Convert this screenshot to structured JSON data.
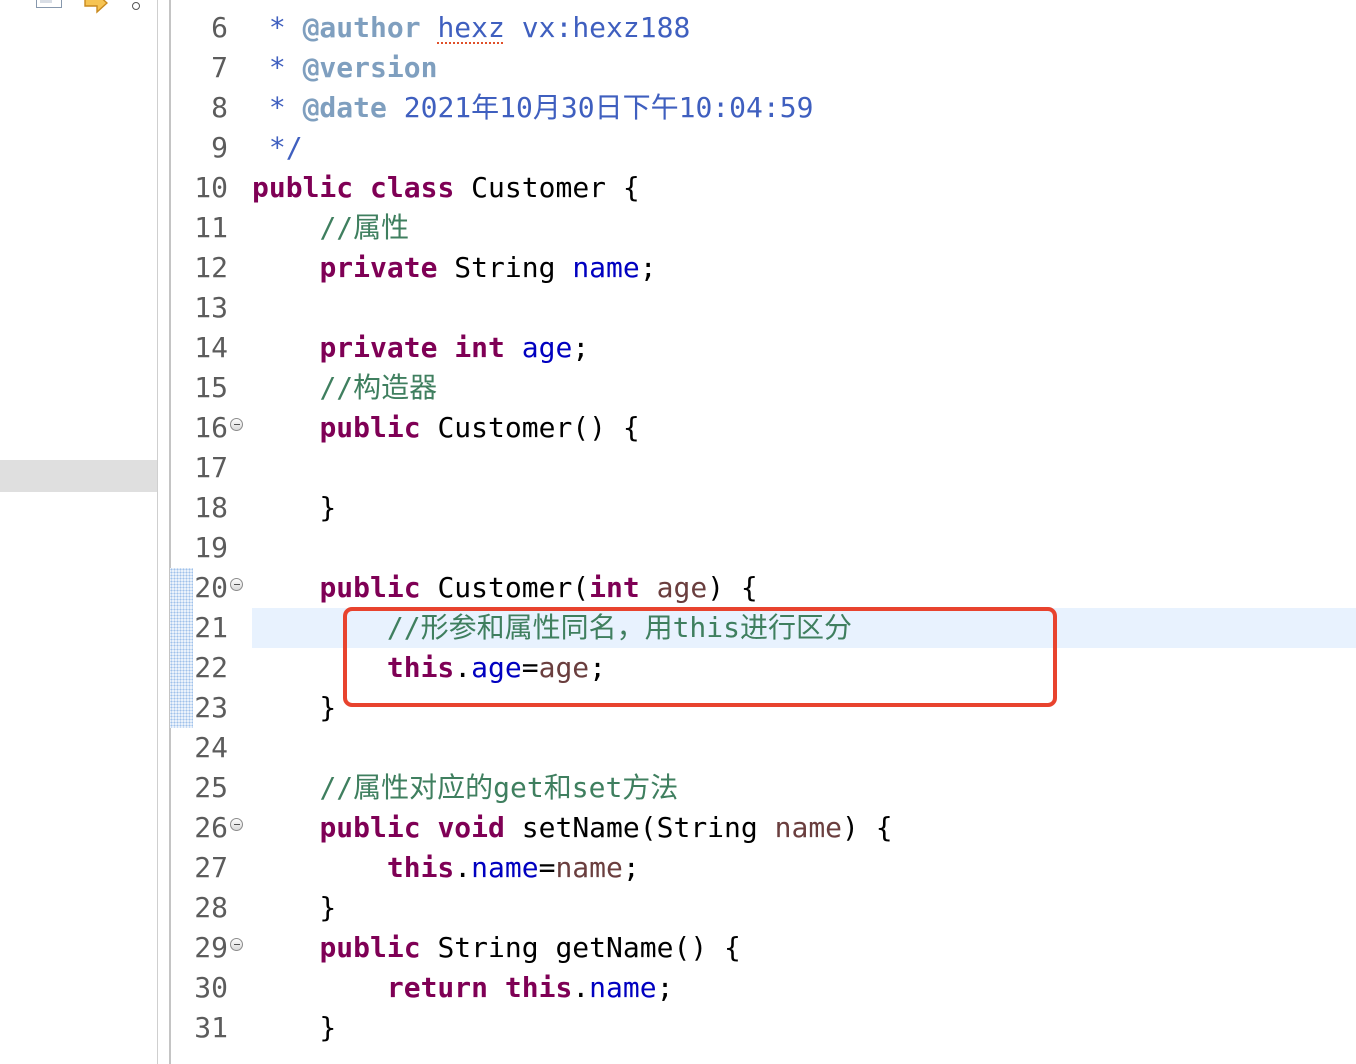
{
  "package_explorer": {
    "toolbar_icons": {
      "collapse_all": "collapse-all-icon",
      "link_with_editor": "link-with-editor-icon",
      "view_menu": "view-menu-icon"
    },
    "selected_row_color": "#dfdfdf"
  },
  "editor": {
    "current_line_color": "#e8f2fe",
    "annotation_color": "#e8432e",
    "fold_icon": "fold-collapse-icon",
    "syntax_colors": {
      "plain": "#000000",
      "keyword": "#7f0055",
      "comment": "#3f7f5f",
      "field": "#0000c0",
      "param": "#6a3e3e",
      "javadoc": "#3f5fbf",
      "javadoc_tag": "#7f9fbf",
      "spell_error": "#e0502a"
    },
    "lines": [
      {
        "number": "6",
        "tokens": [
          {
            "text": " * ",
            "kind": "javadoc"
          },
          {
            "text": "@author",
            "kind": "javadoc_tag"
          },
          {
            "text": " ",
            "kind": "javadoc"
          },
          {
            "text": "hexz",
            "kind": "javadoc",
            "misspelled": true
          },
          {
            "text": " vx:hexz188",
            "kind": "javadoc"
          }
        ]
      },
      {
        "number": "7",
        "tokens": [
          {
            "text": " * ",
            "kind": "javadoc"
          },
          {
            "text": "@version",
            "kind": "javadoc_tag"
          }
        ]
      },
      {
        "number": "8",
        "tokens": [
          {
            "text": " * ",
            "kind": "javadoc"
          },
          {
            "text": "@date",
            "kind": "javadoc_tag"
          },
          {
            "text": " 2021年10月30日下午10:04:59",
            "kind": "javadoc"
          }
        ]
      },
      {
        "number": "9",
        "tokens": [
          {
            "text": " */",
            "kind": "javadoc"
          }
        ]
      },
      {
        "number": "10",
        "tokens": [
          {
            "text": "public",
            "kind": "keyword"
          },
          {
            "text": " ",
            "kind": "plain"
          },
          {
            "text": "class",
            "kind": "keyword"
          },
          {
            "text": " Customer {",
            "kind": "plain"
          }
        ]
      },
      {
        "number": "11",
        "tokens": [
          {
            "text": "    ",
            "kind": "plain"
          },
          {
            "text": "//属性",
            "kind": "comment"
          }
        ]
      },
      {
        "number": "12",
        "tokens": [
          {
            "text": "    ",
            "kind": "plain"
          },
          {
            "text": "private",
            "kind": "keyword"
          },
          {
            "text": " String ",
            "kind": "plain"
          },
          {
            "text": "name",
            "kind": "field"
          },
          {
            "text": ";",
            "kind": "plain"
          }
        ]
      },
      {
        "number": "13",
        "tokens": []
      },
      {
        "number": "14",
        "tokens": [
          {
            "text": "    ",
            "kind": "plain"
          },
          {
            "text": "private",
            "kind": "keyword"
          },
          {
            "text": " ",
            "kind": "plain"
          },
          {
            "text": "int",
            "kind": "keyword"
          },
          {
            "text": " ",
            "kind": "plain"
          },
          {
            "text": "age",
            "kind": "field"
          },
          {
            "text": ";",
            "kind": "plain"
          }
        ]
      },
      {
        "number": "15",
        "tokens": [
          {
            "text": "    ",
            "kind": "plain"
          },
          {
            "text": "//构造器",
            "kind": "comment"
          }
        ]
      },
      {
        "number": "16",
        "fold": true,
        "tokens": [
          {
            "text": "    ",
            "kind": "plain"
          },
          {
            "text": "public",
            "kind": "keyword"
          },
          {
            "text": " Customer() {",
            "kind": "plain"
          }
        ]
      },
      {
        "number": "17",
        "tokens": []
      },
      {
        "number": "18",
        "tokens": [
          {
            "text": "    }",
            "kind": "plain"
          }
        ]
      },
      {
        "number": "19",
        "tokens": []
      },
      {
        "number": "20",
        "fold": true,
        "changed": true,
        "tokens": [
          {
            "text": "    ",
            "kind": "plain"
          },
          {
            "text": "public",
            "kind": "keyword"
          },
          {
            "text": " Customer(",
            "kind": "plain"
          },
          {
            "text": "int",
            "kind": "keyword"
          },
          {
            "text": " ",
            "kind": "plain"
          },
          {
            "text": "age",
            "kind": "param"
          },
          {
            "text": ") {",
            "kind": "plain"
          }
        ]
      },
      {
        "number": "21",
        "current": true,
        "changed": true,
        "tokens": [
          {
            "text": "        ",
            "kind": "plain"
          },
          {
            "text": "//形参和属性同名，用this进行区分",
            "kind": "comment"
          }
        ]
      },
      {
        "number": "22",
        "changed": true,
        "tokens": [
          {
            "text": "        ",
            "kind": "plain"
          },
          {
            "text": "this",
            "kind": "keyword"
          },
          {
            "text": ".",
            "kind": "plain"
          },
          {
            "text": "age",
            "kind": "field"
          },
          {
            "text": "=",
            "kind": "plain"
          },
          {
            "text": "age",
            "kind": "param"
          },
          {
            "text": ";",
            "kind": "plain"
          }
        ]
      },
      {
        "number": "23",
        "changed": true,
        "tokens": [
          {
            "text": "    }",
            "kind": "plain"
          }
        ]
      },
      {
        "number": "24",
        "tokens": []
      },
      {
        "number": "25",
        "tokens": [
          {
            "text": "    ",
            "kind": "plain"
          },
          {
            "text": "//属性对应的get和set方法",
            "kind": "comment"
          }
        ]
      },
      {
        "number": "26",
        "fold": true,
        "tokens": [
          {
            "text": "    ",
            "kind": "plain"
          },
          {
            "text": "public",
            "kind": "keyword"
          },
          {
            "text": " ",
            "kind": "plain"
          },
          {
            "text": "void",
            "kind": "keyword"
          },
          {
            "text": " setName(String ",
            "kind": "plain"
          },
          {
            "text": "name",
            "kind": "param"
          },
          {
            "text": ") {",
            "kind": "plain"
          }
        ]
      },
      {
        "number": "27",
        "tokens": [
          {
            "text": "        ",
            "kind": "plain"
          },
          {
            "text": "this",
            "kind": "keyword"
          },
          {
            "text": ".",
            "kind": "plain"
          },
          {
            "text": "name",
            "kind": "field"
          },
          {
            "text": "=",
            "kind": "plain"
          },
          {
            "text": "name",
            "kind": "param"
          },
          {
            "text": ";",
            "kind": "plain"
          }
        ]
      },
      {
        "number": "28",
        "tokens": [
          {
            "text": "    }",
            "kind": "plain"
          }
        ]
      },
      {
        "number": "29",
        "fold": true,
        "tokens": [
          {
            "text": "    ",
            "kind": "plain"
          },
          {
            "text": "public",
            "kind": "keyword"
          },
          {
            "text": " String getName() {",
            "kind": "plain"
          }
        ]
      },
      {
        "number": "30",
        "tokens": [
          {
            "text": "        ",
            "kind": "plain"
          },
          {
            "text": "return",
            "kind": "keyword"
          },
          {
            "text": " ",
            "kind": "plain"
          },
          {
            "text": "this",
            "kind": "keyword"
          },
          {
            "text": ".",
            "kind": "plain"
          },
          {
            "text": "name",
            "kind": "field"
          },
          {
            "text": ";",
            "kind": "plain"
          }
        ]
      },
      {
        "number": "31",
        "tokens": [
          {
            "text": "    }",
            "kind": "plain"
          }
        ]
      }
    ]
  }
}
